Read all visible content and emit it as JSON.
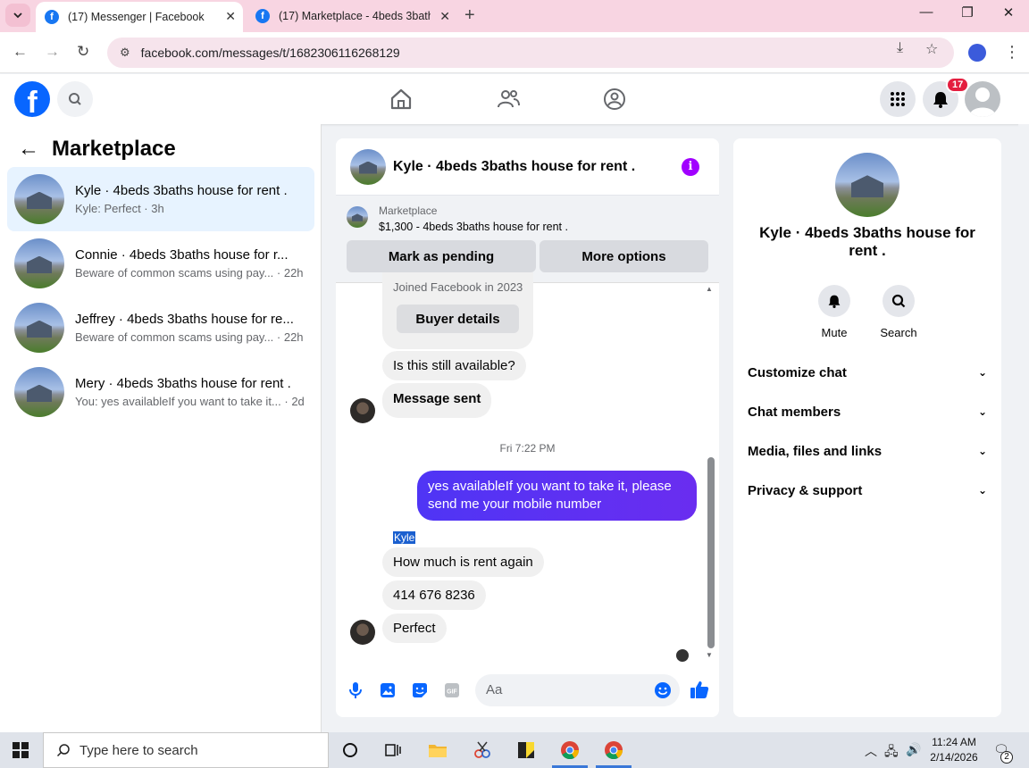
{
  "browser": {
    "tabs": [
      {
        "title": "(17) Messenger | Facebook"
      },
      {
        "title": "(17) Marketplace - 4beds 3bath"
      }
    ],
    "url": "facebook.com/messages/t/1682306116268129"
  },
  "fb_header": {
    "notification_count": "17"
  },
  "left_pane": {
    "title": "Marketplace",
    "conversations": [
      {
        "name": "Kyle · 4beds 3baths house for rent .",
        "preview": "Kyle: Perfect · 3h"
      },
      {
        "name": "Connie · 4beds 3baths house for r...",
        "preview": "Beware of common scams using pay... · 22h"
      },
      {
        "name": "Jeffrey · 4beds 3baths house for re...",
        "preview": "Beware of common scams using pay... · 22h"
      },
      {
        "name": "Mery · 4beds 3baths house for rent .",
        "preview": "You: yes availableIf you want to take it... · 2d"
      }
    ]
  },
  "chat": {
    "title": "Kyle · 4beds 3baths house for rent .",
    "marketplace_label": "Marketplace",
    "listing": "$1,300 - 4beds 3baths house for rent .",
    "mark_pending": "Mark as pending",
    "more_options": "More options",
    "joined": "Joined Facebook in 2023",
    "buyer_details": "Buyer details",
    "messages": {
      "m1": "Is this still available?",
      "m2": "Message sent",
      "timestamp": "Fri 7:22 PM",
      "out1": "yes availableIf you want to take it, please send me your mobile number",
      "sender_label": "Kyle",
      "m3": "How much is rent again",
      "m4": "414 676 8236",
      "m5": "Perfect"
    },
    "composer_placeholder": "Aa"
  },
  "right_pane": {
    "name": "Kyle · 4beds 3baths house for rent .",
    "mute": "Mute",
    "search": "Search",
    "rows": [
      "Customize chat",
      "Chat members",
      "Media, files and links",
      "Privacy & support"
    ]
  },
  "taskbar": {
    "search_placeholder": "Type here to search",
    "time": "11:24 AM",
    "date": "2/14/2026",
    "notif_count": "2"
  },
  "colors": {
    "fb_blue": "#0866ff",
    "outgoing_bubble": "#5b3ef5",
    "badge_red": "#e41e3f",
    "active_conv": "#e7f3ff"
  }
}
